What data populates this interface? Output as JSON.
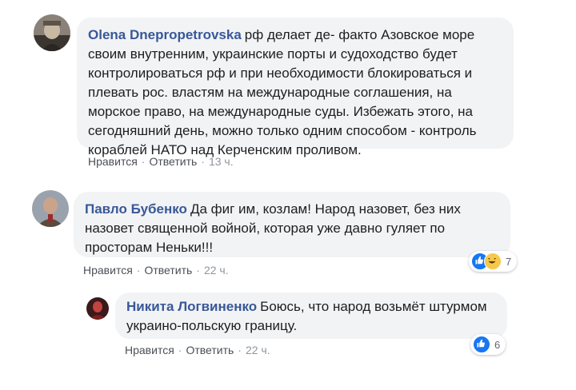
{
  "comments": [
    {
      "author": "Olena Dnepropetrovska",
      "text": "рф делает де- факто Азовское море своим внутренним, украинские порты и судоходство будет контролироваться рф и при необходимости блокироваться и плевать рос. властям на международные соглашения, на морское право, на международные суды. Избежать этого, на сегодняшний день, можно только одним способом - контроль кораблей НАТО над Керченским проливом.",
      "like_label": "Нравится",
      "reply_label": "Ответить",
      "time": "13 ч."
    },
    {
      "author": "Павло Бубенко",
      "text": "Да фиг им, козлам! Народ назовет, без них назовет священной войной, которая уже давно гуляет по просторам Неньки!!!",
      "like_label": "Нравится",
      "reply_label": "Ответить",
      "time": "22 ч.",
      "reaction_count": "7"
    },
    {
      "author": "Никита Логвиненко",
      "text": "Боюсь, что народ возьмёт штурмом украино-польскую границу.",
      "like_label": "Нравится",
      "reply_label": "Ответить",
      "time": "22 ч.",
      "reaction_count": "6"
    }
  ],
  "separator": "·",
  "colors": {
    "author": "#385898",
    "bubble": "#f2f3f5",
    "like_reaction": "#1877f2",
    "haha_reaction": "#f7c94b"
  }
}
